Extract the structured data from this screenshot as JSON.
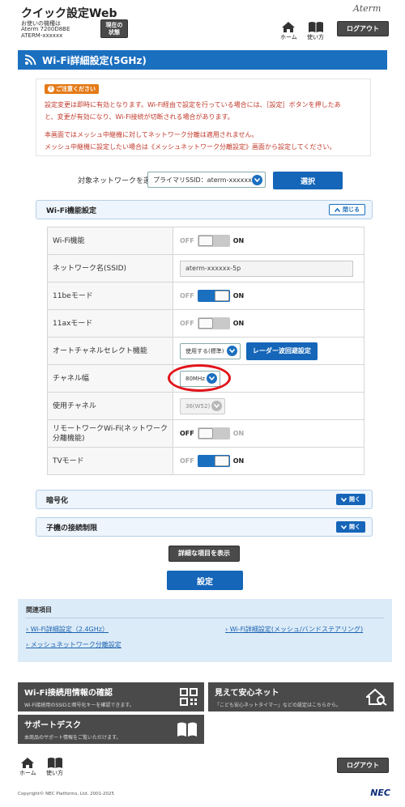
{
  "header": {
    "title": "クイック設定Web",
    "device_line1": "お使いの機種は",
    "device_line2": "Aterm 7200D8BE",
    "device_line3": "ATERM-xxxxxx",
    "status_button": "現在の\n状態",
    "home_label": "ホーム",
    "help_label": "使い方",
    "logout_label": "ログアウト",
    "logo": "Aterm"
  },
  "page_title": "Wi-Fi詳細設定(5GHz)",
  "notice": {
    "badge": "ご注意ください",
    "line1": "設定変更は即時に有効となります。Wi-Fi経由で設定を行っている場合には、［設定］ボタンを押したあ",
    "line2": "と、変更が有効になり、Wi-Fi接続が切断される場合があります。",
    "line3": "本画面ではメッシュ中継機に対してネットワーク分離は適用されません。",
    "line4": "メッシュ中継機に設定したい場合は《メッシュネットワーク分離設定》画面から設定してください。"
  },
  "network_select": {
    "label": "対象ネットワークを選択",
    "value": "プライマリSSID：aterm-xxxxxx-5p",
    "button": "選択"
  },
  "wifi_section": {
    "title": "Wi-Fi機能設定",
    "toggle_label": "閉じる",
    "off_text": "OFF",
    "on_text": "ON",
    "rows": [
      {
        "label": "Wi-Fi機能",
        "type": "switch",
        "on": false
      },
      {
        "label": "ネットワーク名(SSID)",
        "type": "input",
        "value": "aterm-xxxxxx-5p"
      },
      {
        "label": "11beモード",
        "type": "switch",
        "on": true
      },
      {
        "label": "11axモード",
        "type": "switch",
        "on": false
      },
      {
        "label": "オートチャネルセレクト機能",
        "type": "select",
        "value": "使用する(標準)",
        "button": "レーダー波回避設定"
      },
      {
        "label": "チャネル幅",
        "type": "select",
        "value": "80MHz"
      },
      {
        "label": "使用チャネル",
        "type": "select-disabled",
        "value": "36(W52)"
      },
      {
        "label": "リモートワークWi-Fi(ネットワーク分離機能)",
        "type": "switch",
        "on": false,
        "emphasis_off": true
      },
      {
        "label": "TVモード",
        "type": "switch",
        "on": true
      }
    ]
  },
  "encryption_section": {
    "title": "暗号化",
    "toggle_label": "開く"
  },
  "client_section": {
    "title": "子機の接続制限",
    "toggle_label": "開く"
  },
  "show_detail_button": "詳細な項目を表示",
  "save_button": "設定",
  "related": {
    "title": "関連項目",
    "links": [
      "Wi-Fi詳細設定（2.4GHz）",
      "Wi-Fi詳細設定(メッシュ/バンドステアリング)",
      "メッシュネットワーク分離設定"
    ]
  },
  "tiles": [
    {
      "title": "Wi-Fi接続用情報の確認",
      "sub": "Wi-Fi接続用のSSIDと暗号化キーを確認できます。"
    },
    {
      "title": "見えて安心ネット",
      "sub": "「こども安心ネットタイマー」などの設定はこちらから。"
    },
    {
      "title": "サポートデスク",
      "sub": "本商品のサポート情報をご覧いただけます。"
    }
  ],
  "footer": {
    "home_label": "ホーム",
    "help_label": "使い方",
    "logout_label": "ログアウト",
    "copyright": "Copyright© NEC Platforms, Ltd. 2001-2025",
    "brand": "NEC"
  },
  "colors": {
    "accent": "#1b6fbf",
    "highlight": "#e2141b",
    "notice_text": "#c0392b"
  }
}
